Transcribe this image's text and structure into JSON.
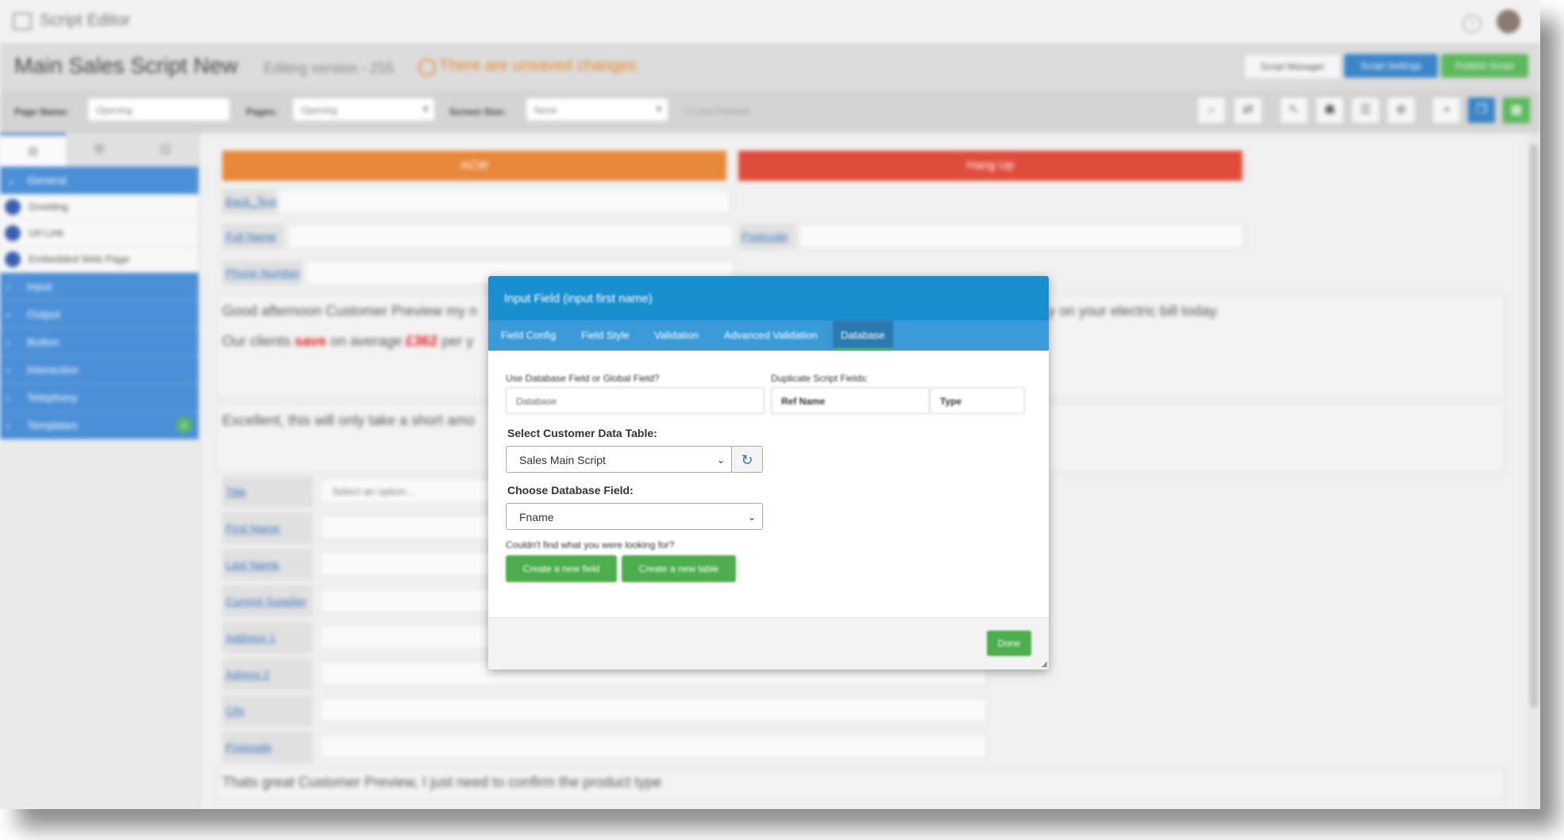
{
  "window": {
    "app_title": "Script Editor",
    "help_label": "?"
  },
  "header": {
    "script_title": "Main Sales Script New",
    "version": "Editing version - 255",
    "unsaved_warning": "There are unsaved changes",
    "script_manager_label": "Script Manager",
    "script_settings_label": "Script Settings",
    "publish_label": "Publish Script"
  },
  "toolbar": {
    "page_name_label": "Page Name:",
    "page_name_value": "Opening",
    "pages_label": "Pages:",
    "pages_value": "Opening",
    "screen_size_label": "Screen Size:",
    "screen_size_value": "None",
    "live_preview_label": "Live Preview"
  },
  "sidebar": {
    "general_label": "General",
    "general_items": [
      "Greeting",
      "Url Link",
      "Embedded Web Page"
    ],
    "categories": [
      "Input",
      "Output",
      "Button",
      "Interaction",
      "Telephony",
      "Templates"
    ]
  },
  "canvas": {
    "acw_label": "ACW",
    "hangup_label": "Hang Up",
    "fields_top": [
      {
        "label": "Back_Text",
        "value": ""
      },
      {
        "label": "Full Name",
        "value": ""
      },
      {
        "label": "Postcode",
        "value": ""
      },
      {
        "label": "Phone Number",
        "value": ""
      }
    ],
    "para1_a": "Good afternoon Customer Preview my n",
    "para1_b": "y on your electric bill today.",
    "para2_a": "Our clients ",
    "para2_save": "save",
    "para2_b": " on average ",
    "para2_amount": "£362",
    "para2_c": " per y",
    "para3": "Excellent, this will only take a short amo",
    "form_fields": [
      {
        "label": "Title",
        "value": "Select an option..."
      },
      {
        "label": "First Name",
        "value": ""
      },
      {
        "label": "Last Name",
        "value": ""
      },
      {
        "label": "Current Supplier",
        "value": ""
      },
      {
        "label": "Address 1",
        "value": ""
      },
      {
        "label": "Adress 2",
        "value": ""
      },
      {
        "label": "City",
        "value": ""
      },
      {
        "label": "Postcode",
        "value": ""
      }
    ],
    "para4": "Thats great Customer Preview, I just need to confirm the product type"
  },
  "modal": {
    "title": "Input Field (input first name)",
    "tabs": [
      "Field Config",
      "Field Style",
      "Validation",
      "Advanced Validation",
      "Database"
    ],
    "use_db_label": "Use Database Field or Global Field?",
    "use_db_value": "Database",
    "duplicate_label": "Duplicate Script Fields:",
    "dup_col_ref": "Ref Name",
    "dup_col_type": "Type",
    "select_table_label": "Select Customer Data Table:",
    "table_value": "Sales Main Script",
    "choose_field_label": "Choose Database Field:",
    "field_value": "Fname",
    "couldnt_find": "Couldn't find what you were looking for?",
    "create_field_label": "Create a new field",
    "create_table_label": "Create a new table",
    "done_label": "Done"
  }
}
